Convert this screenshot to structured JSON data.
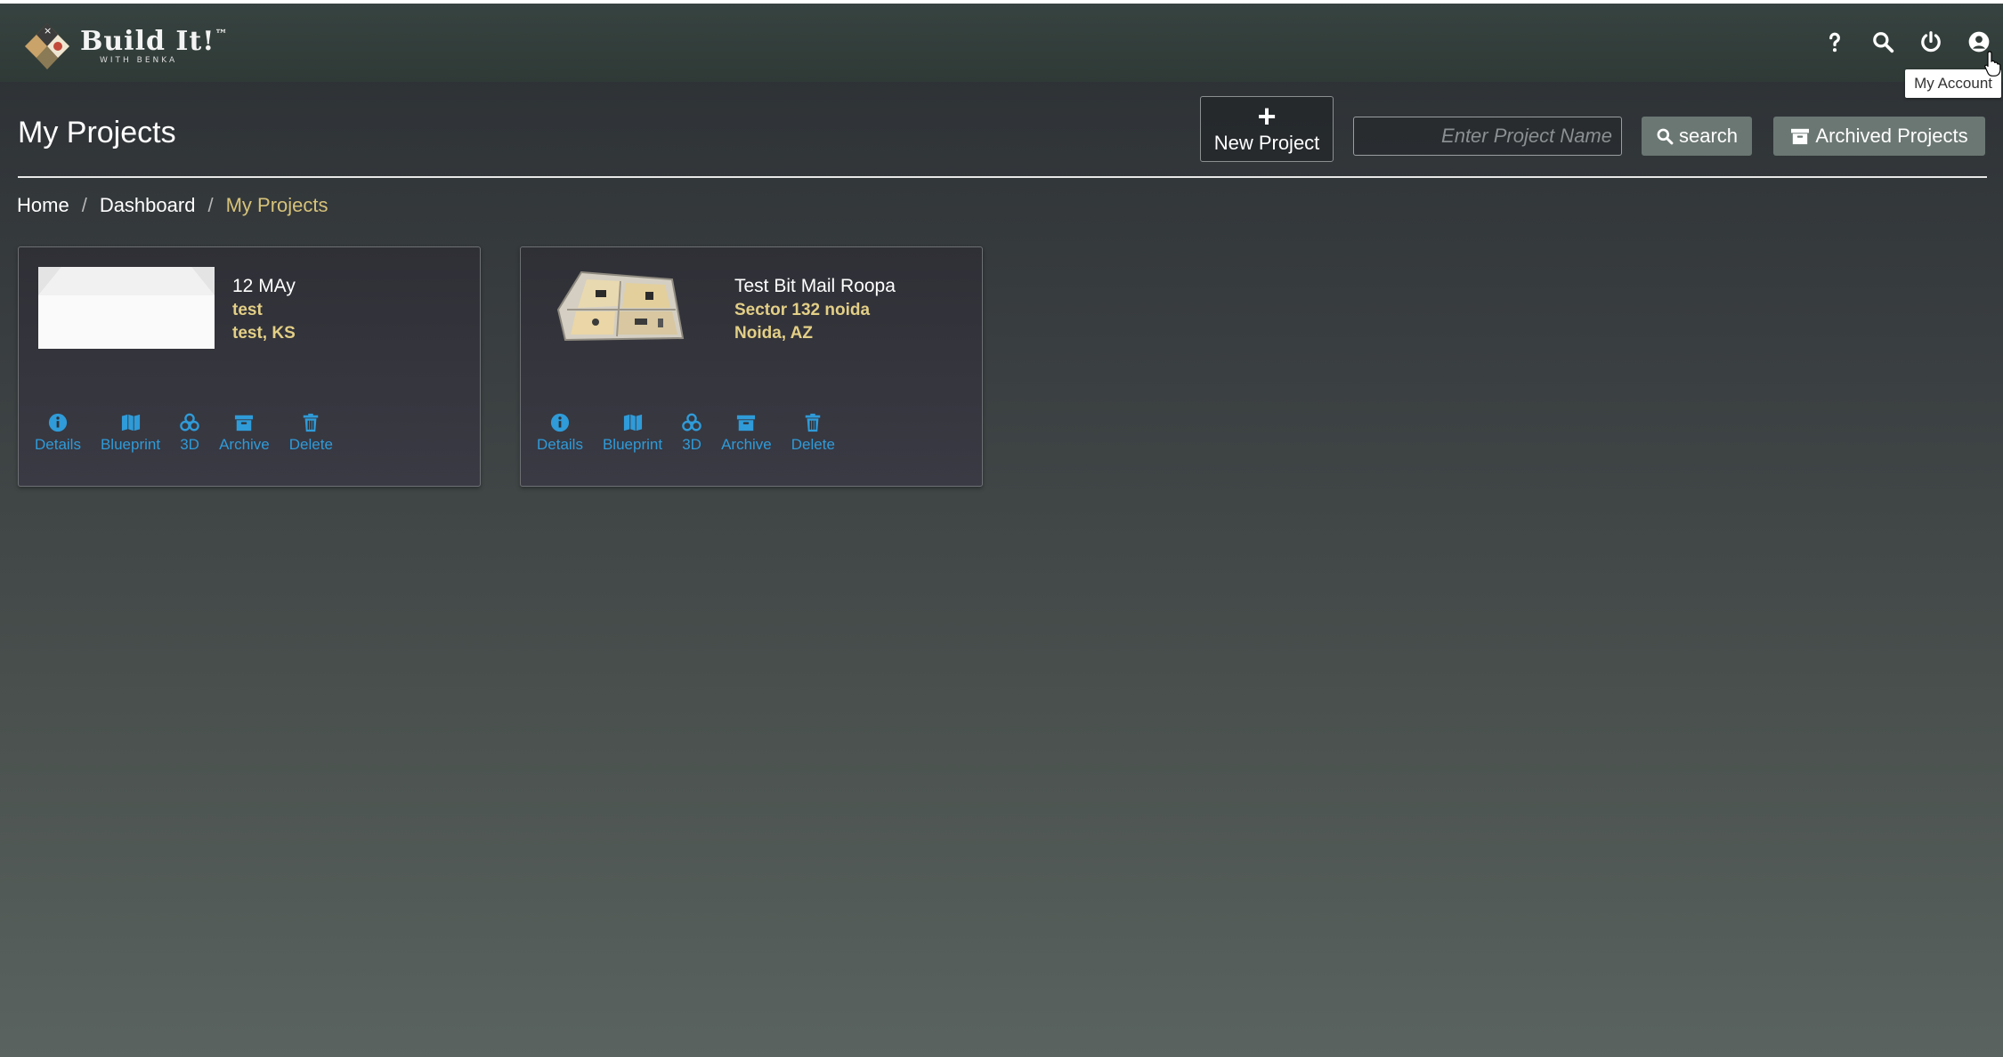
{
  "header": {
    "logo_title": "Build It!",
    "logo_trademark": "™",
    "logo_subtitle": "WITH BENKA",
    "icons": [
      "help-icon",
      "search-icon",
      "power-icon",
      "account-icon"
    ],
    "tooltip": "My Account"
  },
  "page": {
    "title": "My Projects",
    "new_project_label": "New Project",
    "search_placeholder": "Enter Project Name",
    "search_label": "search",
    "archived_label": "Archived Projects"
  },
  "breadcrumb": {
    "home": "Home",
    "dashboard": "Dashboard",
    "current": "My Projects",
    "separator": "/"
  },
  "projects": [
    {
      "name": "12 MAy",
      "line1": "test",
      "line2": "test, KS",
      "actions": [
        "Details",
        "Blueprint",
        "3D",
        "Archive",
        "Delete"
      ]
    },
    {
      "name": "Test Bit Mail Roopa",
      "line1": "Sector 132 noida",
      "line2": "Noida, AZ",
      "actions": [
        "Details",
        "Blueprint",
        "3D",
        "Archive",
        "Delete"
      ]
    }
  ],
  "colors": {
    "accent_blue": "#2f9bd8",
    "address_gold": "#e3cf86",
    "breadcrumb_active": "#d6c27a",
    "button_gray": "#6b7773",
    "topbar": "#374340"
  }
}
